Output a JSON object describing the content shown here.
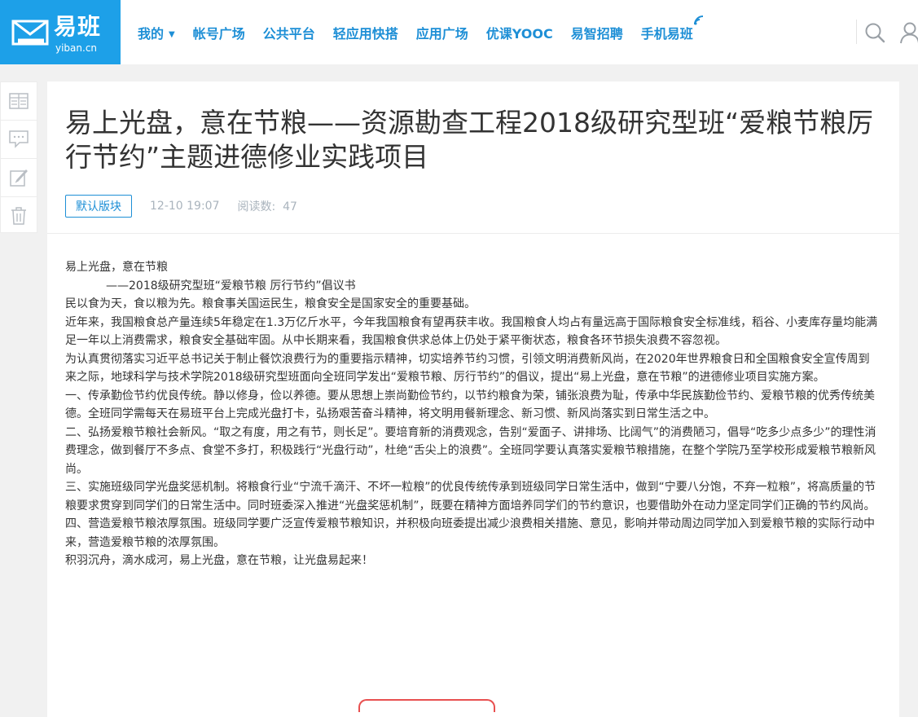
{
  "header": {
    "brand": "易班",
    "domain": "yiban.cn",
    "nav": [
      {
        "label": "我的"
      },
      {
        "label": "帐号广场"
      },
      {
        "label": "公共平台"
      },
      {
        "label": "轻应用快搭"
      },
      {
        "label": "应用广场"
      },
      {
        "label": "优课YOOC"
      },
      {
        "label": "易智招聘"
      },
      {
        "label": "手机易班"
      }
    ],
    "accent": "#1da0e8",
    "nav_color": "#1e8fd6"
  },
  "sidebar": {
    "tools": [
      "layout-icon",
      "comment-icon",
      "edit-icon",
      "trash-icon"
    ]
  },
  "article": {
    "title": "易上光盘，意在节粮——资源勘查工程2018级研究型班“爱粮节粮厉行节约”主题进德修业实践项目",
    "tag": "默认版块",
    "date": "12-10 19:07",
    "reads_label": "阅读数:",
    "reads_count": "47",
    "paragraphs": [
      "易上光盘，意在节粮",
      "——2018级研究型班“爱粮节粮 厉行节约”倡议书",
      "民以食为天，食以粮为先。粮食事关国运民生，粮食安全是国家安全的重要基础。",
      "近年来，我国粮食总产量连续5年稳定在1.3万亿斤水平，今年我国粮食有望再获丰收。我国粮食人均占有量远高于国际粮食安全标准线，稻谷、小麦库存量均能满足一年以上消费需求，粮食安全基础牢固。从中长期来看，我国粮食供求总体上仍处于紧平衡状态，粮食各环节损失浪费不容忽视。",
      "为认真贯彻落实习近平总书记关于制止餐饮浪费行为的重要指示精神，切实培养节约习惯，引领文明消费新风尚，在2020年世界粮食日和全国粮食安全宣传周到来之际，地球科学与技术学院2018级研究型班面向全班同学发出“爱粮节粮、厉行节约”的倡议，提出“易上光盘，意在节粮”的进德修业项目实施方案。",
      "一、传承勤俭节约优良传统。静以修身，俭以养德。要从思想上崇尚勤俭节约，以节约粮食为荣，铺张浪费为耻，传承中华民族勤俭节约、爱粮节粮的优秀传统美德。全班同学需每天在易班平台上完成光盘打卡，弘扬艰苦奋斗精神，将文明用餐新理念、新习惯、新风尚落实到日常生活之中。",
      "二、弘扬爱粮节粮社会新风。“取之有度，用之有节，则长足”。要培育新的消费观念，告别“爱面子、讲排场、比阔气”的消费陋习，倡导“吃多少点多少”的理性消费理念，做到餐厅不多点、食堂不多打，积极践行“光盘行动”，杜绝“舌尖上的浪费”。全班同学要认真落实爱粮节粮措施，在整个学院乃至学校形成爱粮节粮新风尚。",
      "三、实施班级同学光盘奖惩机制。将粮食行业“宁流千滴汗、不坏一粒粮”的优良传统传承到班级同学日常生活中，做到“宁要八分饱，不弃一粒粮”，将高质量的节粮要求贯穿到同学们的日常生活中。同时班委深入推进“光盘奖惩机制”，既要在精神方面培养同学们的节约意识，也要借助外在动力坚定同学们正确的节约风尚。",
      "四、营造爱粮节粮浓厚氛围。班级同学要广泛宣传爱粮节粮知识，并积极向班委提出减少浪费相关措施、意见，影响并带动周边同学加入到爱粮节粮的实际行动中来，营造爱粮节粮的浓厚氛围。",
      "积羽沉舟，滴水成河，易上光盘，意在节粮，让光盘易起来！"
    ]
  }
}
